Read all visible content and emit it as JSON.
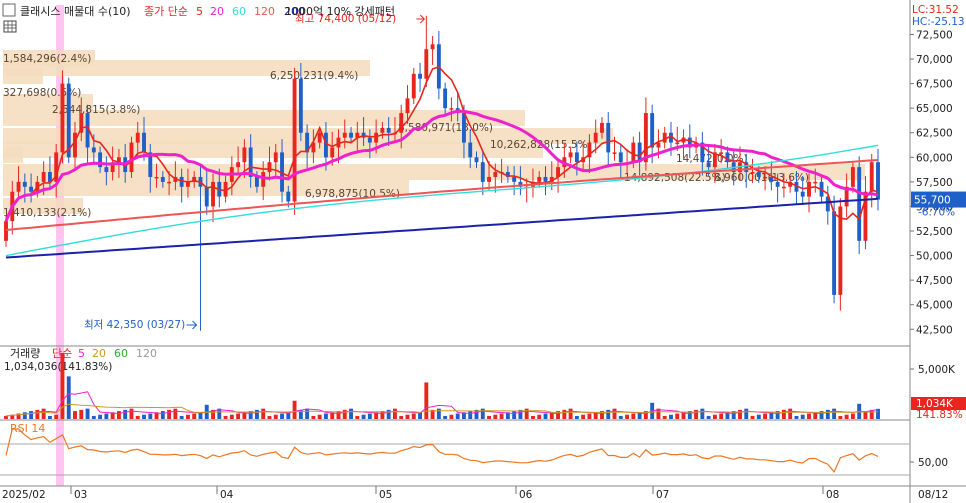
{
  "header": {
    "title": "클래시스 매물대 수(10)",
    "ma_label": "종가 단순",
    "ma_periods": [
      "5",
      "20",
      "60",
      "120",
      "200"
    ],
    "strength_pattern": "1000억 10% 강세패턴",
    "lc": "LC:31.52",
    "hc": "HC:-25.13"
  },
  "colors": {
    "up": "#e8251f",
    "down": "#1f5fc8",
    "ma5": "#e8251f",
    "ma20": "#ee22cc",
    "ma60": "#33dddd",
    "ma120": "#ee5555",
    "ma200": "#1a22aa",
    "profile": "#f5dcbd",
    "rsi": "#ee7722",
    "price_label": "#1f5fc8"
  },
  "price_panel": {
    "y_ticks": [
      "72,500",
      "70,000",
      "67,500",
      "65,000",
      "62,500",
      "60,000",
      "57,500",
      "55,000",
      "52,500",
      "50,000",
      "47,500",
      "45,000",
      "42,500"
    ],
    "current_price": "55,700",
    "current_change": "-6.70%",
    "high_annotation": "최고 74,400 (05/12)",
    "low_annotation": "최저 42,350 (03/27)",
    "volume_profile": [
      {
        "label": "1,584,296(2.4%)"
      },
      {
        "label": "327,698(0.5%)"
      },
      {
        "label": "2,544,815(3.8%)"
      },
      {
        "label": "6,250,231(9.4%)"
      },
      {
        "label": "8,580,971(13.0%)"
      },
      {
        "label": "10,262,828(15.5%)"
      },
      {
        "label": "14,472(0.0%)"
      },
      {
        "label": "14,892,508(22.5%)"
      },
      {
        "label": "8,960,001(13.6%)"
      },
      {
        "label": "6,978,875(10.5%)"
      },
      {
        "label": "1,410,133(2.1%)"
      }
    ]
  },
  "volume_panel": {
    "title": "거래량",
    "ma_label": "단순",
    "ma_periods": [
      "5",
      "20",
      "60",
      "120"
    ],
    "readout": "1,034,036(141.83%)",
    "y_tick": "5,000K",
    "current": "1,034K",
    "current_pct": "141.83%"
  },
  "rsi_panel": {
    "title": "RSI 14",
    "y_tick": "50,00"
  },
  "x_axis": {
    "labels": [
      "2025/02",
      "03",
      "04",
      "05",
      "06",
      "07",
      "08",
      "08/12"
    ]
  },
  "chart_data": {
    "type": "candlestick",
    "period": "daily",
    "y_range": [
      41000,
      75500
    ],
    "x_labels": [
      "2025/02",
      "03",
      "04",
      "05",
      "06",
      "07",
      "08"
    ],
    "highest": {
      "value": 74400,
      "date": "05/12"
    },
    "lowest": {
      "value": 42350,
      "date": "03/27"
    },
    "last_close": 55700,
    "last_change_pct": -6.7,
    "closes": [
      53500,
      56500,
      57500,
      57000,
      56500,
      57500,
      58500,
      57500,
      60500,
      67500,
      60000,
      62500,
      64500,
      61000,
      60500,
      59000,
      58500,
      59500,
      60000,
      58500,
      61500,
      62500,
      60500,
      58000,
      58000,
      57500,
      57500,
      58000,
      57000,
      57500,
      58000,
      57000,
      55000,
      57500,
      56000,
      57500,
      59000,
      59500,
      61000,
      58000,
      57000,
      58500,
      59500,
      60500,
      56500,
      55500,
      68000,
      62500,
      60500,
      61500,
      62500,
      60000,
      61000,
      62000,
      62500,
      62000,
      62500,
      62000,
      61500,
      62500,
      63000,
      62500,
      62500,
      64500,
      66000,
      68500,
      68000,
      71000,
      71500,
      67000,
      65000,
      65000,
      64500,
      61500,
      60000,
      59500,
      57500,
      58000,
      58500,
      58500,
      58000,
      57500,
      57000,
      57000,
      57500,
      58000,
      57500,
      58000,
      59000,
      60000,
      60500,
      59500,
      60000,
      61500,
      62500,
      63500,
      60500,
      60500,
      59500,
      59500,
      61500,
      59500,
      64500,
      61000,
      61500,
      62500,
      61500,
      61500,
      62000,
      61000,
      61500,
      59500,
      59000,
      60500,
      60500,
      59500,
      58500,
      59500,
      58500,
      58500,
      58000,
      58000,
      57500,
      57000,
      57000,
      57500,
      56500,
      56000,
      57500,
      57500,
      56000,
      54500,
      46000,
      55000,
      57000,
      59000,
      51500,
      56500,
      59500,
      55700
    ],
    "series_names": [
      "5",
      "20",
      "60",
      "120",
      "200"
    ]
  }
}
